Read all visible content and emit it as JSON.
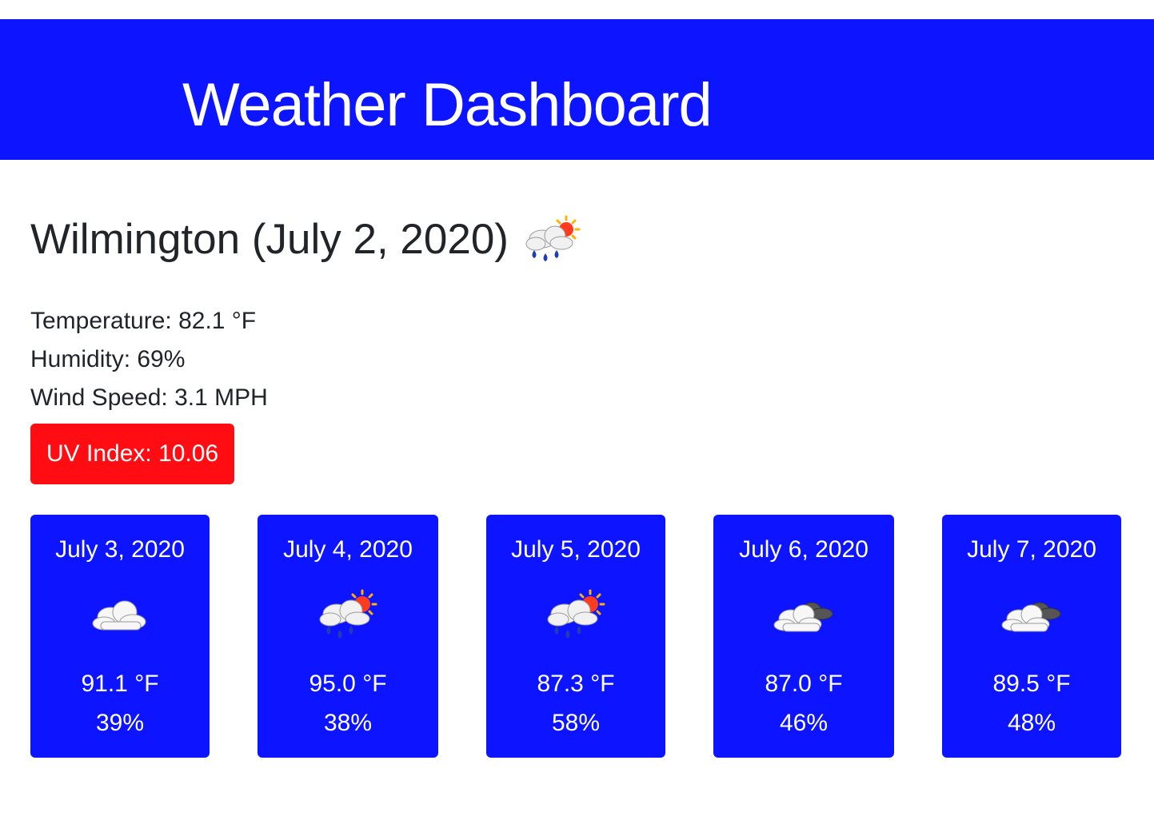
{
  "header": {
    "title": "Weather Dashboard"
  },
  "current": {
    "city_line": "Wilmington (July 2, 2020)",
    "icon": "rain-sun-icon",
    "temperature": "Temperature: 82.1 °F",
    "humidity": "Humidity: 69%",
    "wind": "Wind Speed: 3.1 MPH",
    "uv": "UV Index: 10.06",
    "uv_color": "#ff0d12"
  },
  "colors": {
    "brand": "#0d14ff"
  },
  "forecast": [
    {
      "date": "July 3, 2020",
      "icon": "cloud-icon",
      "temp": "91.1 °F",
      "humidity": "39%"
    },
    {
      "date": "July 4, 2020",
      "icon": "rain-sun-icon",
      "temp": "95.0 °F",
      "humidity": "38%"
    },
    {
      "date": "July 5, 2020",
      "icon": "rain-sun-icon",
      "temp": "87.3 °F",
      "humidity": "58%"
    },
    {
      "date": "July 6, 2020",
      "icon": "broken-clouds-icon",
      "temp": "87.0 °F",
      "humidity": "46%"
    },
    {
      "date": "July 7, 2020",
      "icon": "broken-clouds-icon",
      "temp": "89.5 °F",
      "humidity": "48%"
    }
  ]
}
